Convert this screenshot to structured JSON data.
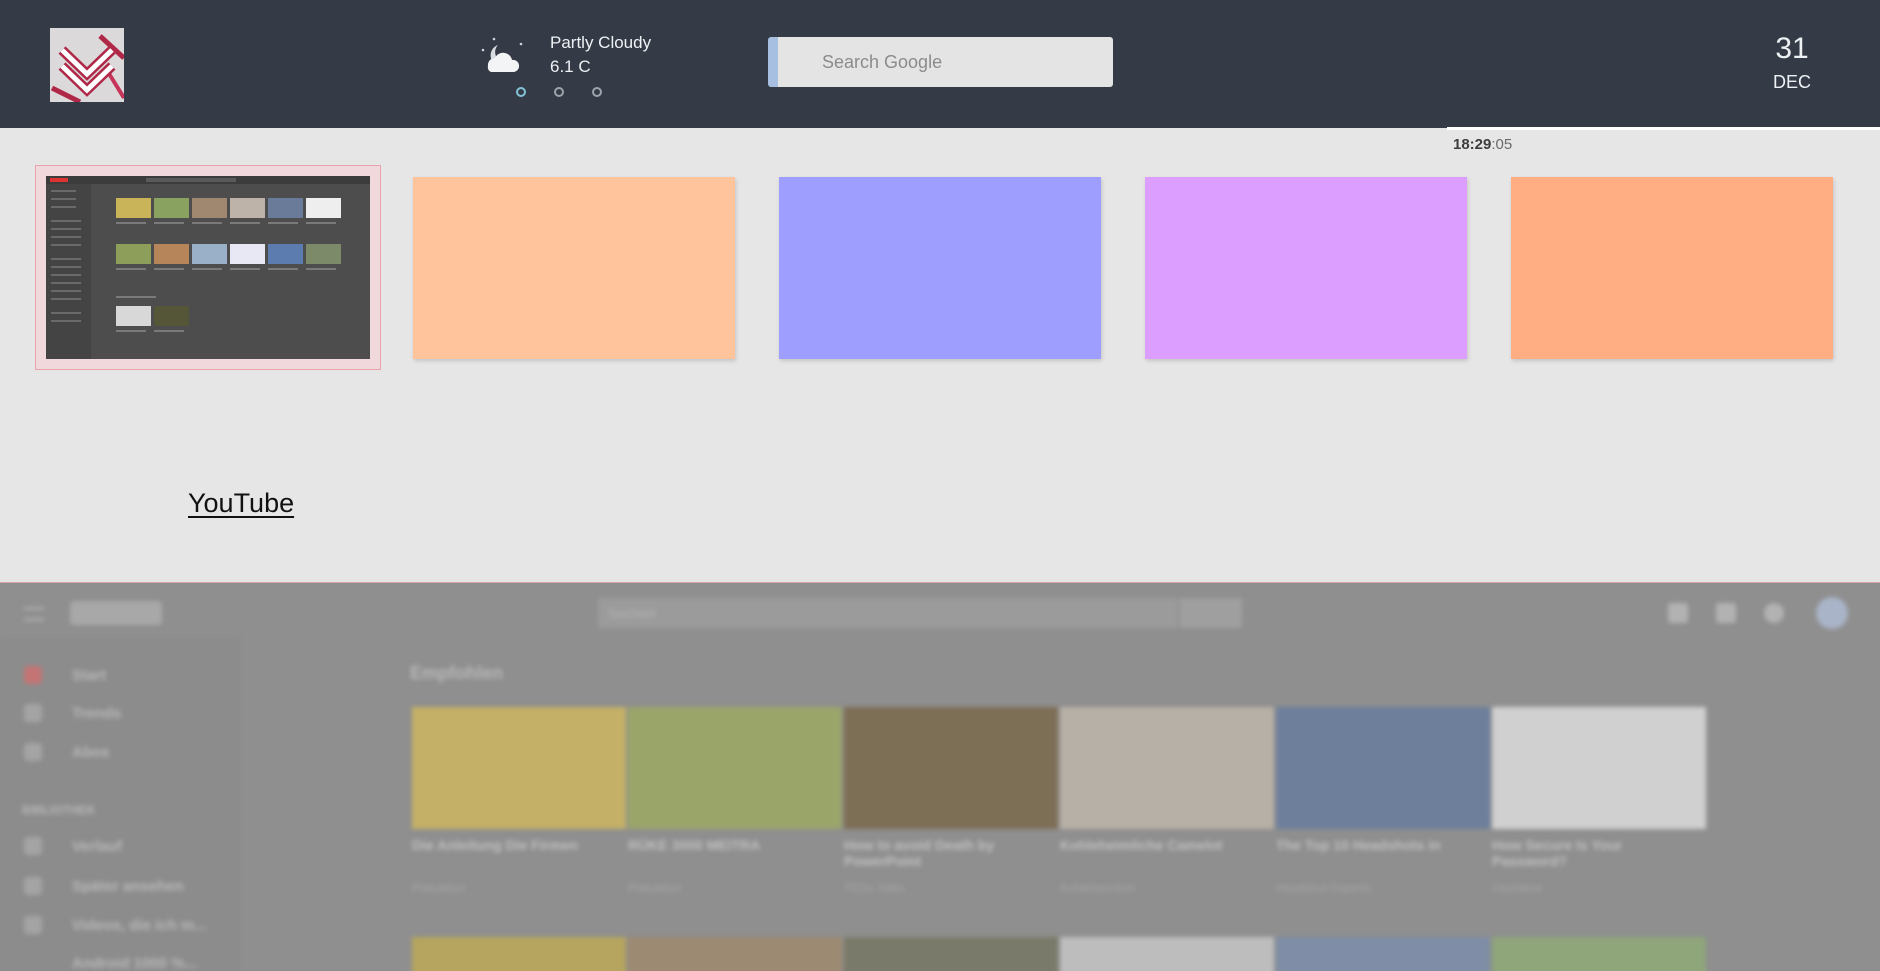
{
  "weather": {
    "condition": "Partly Cloudy",
    "temperature": "6.1 C",
    "icon": "partly-cloudy-night-icon"
  },
  "search": {
    "placeholder": "Search Google"
  },
  "date": {
    "day": "31",
    "month": "DEC"
  },
  "clock": {
    "hours_minutes": "18:29",
    "seconds": ":05"
  },
  "progress": {
    "fraction": 0.23
  },
  "pager": {
    "count": 3,
    "active": 1
  },
  "tiles": [
    {
      "label": "YouTube",
      "color": "#4d4d4d",
      "selected": true
    },
    {
      "color": "#ffc49c"
    },
    {
      "color": "#9e9efe"
    },
    {
      "color": "#dc9eff"
    },
    {
      "color": "#feae82"
    }
  ],
  "selected_tile_title": "YouTube",
  "colors": {
    "topbar": "#343b46",
    "background": "#e6e6e6",
    "accent": "#a7c0e2",
    "selection": "#eaa2ab"
  },
  "background_page": {
    "search_placeholder": "Suchen",
    "nav": [
      "Start",
      "Trends",
      "Abos"
    ],
    "section_label": "BIBLIOTHEK",
    "library": [
      "Verlauf",
      "Später ansehen",
      "Videos, die ich m...",
      "Android 1000 %..."
    ],
    "shelf_title": "Empfohlen",
    "videos": [
      {
        "title": "Die Anleitung Die Firmen",
        "channel": "Plakatbiet"
      },
      {
        "title": "RÜKE 3000 MEITRA",
        "channel": "Plakatbiet"
      },
      {
        "title": "How to avoid Death by PowerPoint",
        "channel": "TEDx Talks"
      },
      {
        "title": "Kohleheimliche Camelot",
        "channel": "Kohleheimlich"
      },
      {
        "title": "The Top 10 Headshots in",
        "channel": "Headshot Experts"
      },
      {
        "title": "How Secure Is Your Password?",
        "channel": "Dashlane"
      }
    ]
  }
}
